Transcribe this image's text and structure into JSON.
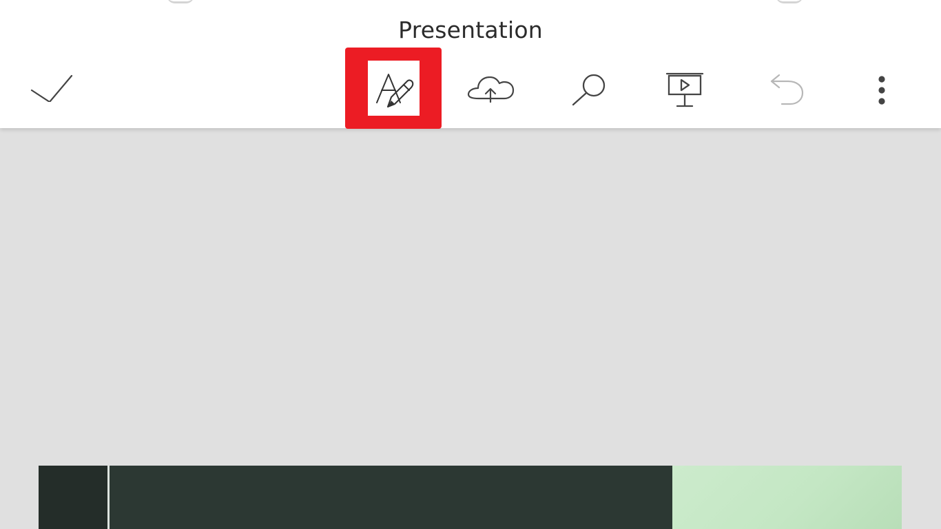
{
  "header": {
    "title": "Presentation"
  },
  "toolbar": {
    "done": {
      "icon": "checkmark-icon"
    },
    "format": {
      "icon": "text-format-pencil-icon",
      "highlight_color": "#ec1c24"
    },
    "upload": {
      "icon": "cloud-upload-icon"
    },
    "search": {
      "icon": "search-icon"
    },
    "present": {
      "icon": "presentation-screen-icon"
    },
    "undo": {
      "icon": "undo-icon",
      "state": "disabled"
    },
    "more": {
      "icon": "more-vertical-icon"
    }
  },
  "colors": {
    "toolbar_background": "#ffffff",
    "canvas_background": "#e0e0e0",
    "icon_color": "#444444",
    "disabled_icon_color": "#b7b7b7",
    "slide_dark": "#2d3833",
    "slide_green": "#c4e7c4"
  }
}
